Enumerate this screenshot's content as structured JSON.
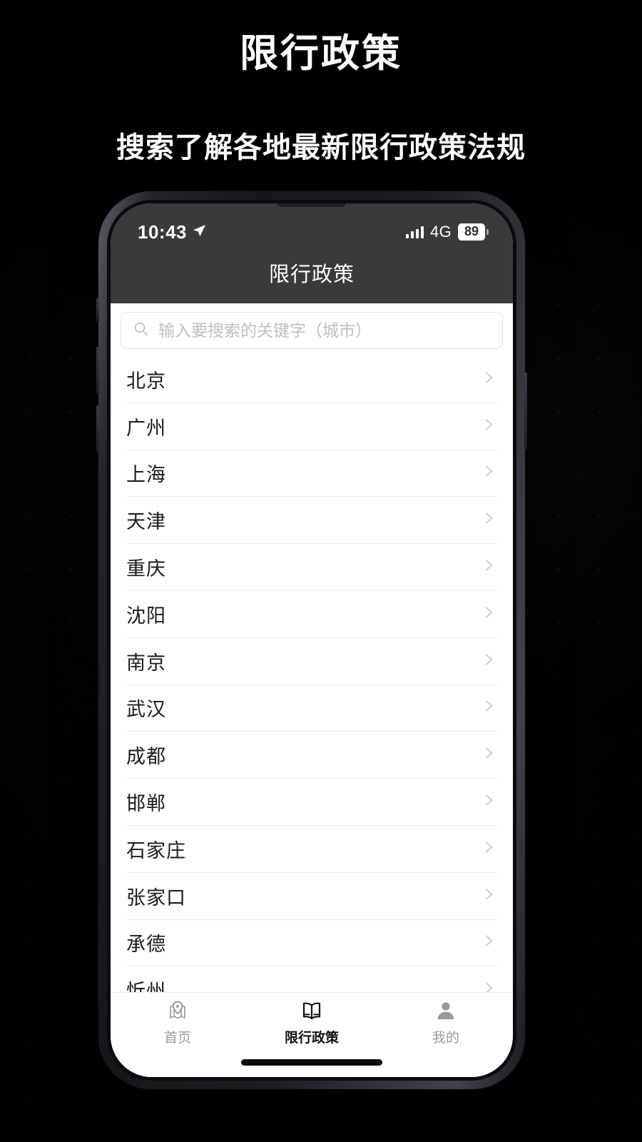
{
  "promo": {
    "title": "限行政策",
    "subtitle": "搜索了解各地最新限行政策法规",
    "background_color": "#0a0a0a",
    "text_color": "#ffffff"
  },
  "phone": {
    "status_bar": {
      "time": "10:43",
      "location_icon": "location-arrow-icon",
      "signal_icon": "signal-bars-icon",
      "network_type": "4G",
      "battery_level": "89",
      "background_color": "#3a3a3c"
    },
    "nav_bar": {
      "title": "限行政策",
      "background_color": "#3a3a3c",
      "title_color": "#ffffff"
    },
    "search": {
      "icon": "search-icon",
      "value": "",
      "placeholder": "输入要搜索的关键字（城市）",
      "placeholder_color": "#bfbfc2",
      "border_color": "#e2e2e4"
    },
    "city_list": {
      "chevron_icon": "chevron-right-icon",
      "divider_color": "#ececec",
      "items": [
        {
          "name": "北京"
        },
        {
          "name": "广州"
        },
        {
          "name": "上海"
        },
        {
          "name": "天津"
        },
        {
          "name": "重庆"
        },
        {
          "name": "沈阳"
        },
        {
          "name": "南京"
        },
        {
          "name": "武汉"
        },
        {
          "name": "成都"
        },
        {
          "name": "邯郸"
        },
        {
          "name": "石家庄"
        },
        {
          "name": "张家口"
        },
        {
          "name": "承德"
        },
        {
          "name": "忻州"
        }
      ]
    },
    "tab_bar": {
      "active_index": 1,
      "active_color": "#111111",
      "inactive_color": "#9a9a9a",
      "tabs": [
        {
          "label": "首页",
          "icon": "map-pin-icon"
        },
        {
          "label": "限行政策",
          "icon": "open-book-icon"
        },
        {
          "label": "我的",
          "icon": "person-icon"
        }
      ]
    },
    "home_indicator": "home-indicator-bar"
  }
}
